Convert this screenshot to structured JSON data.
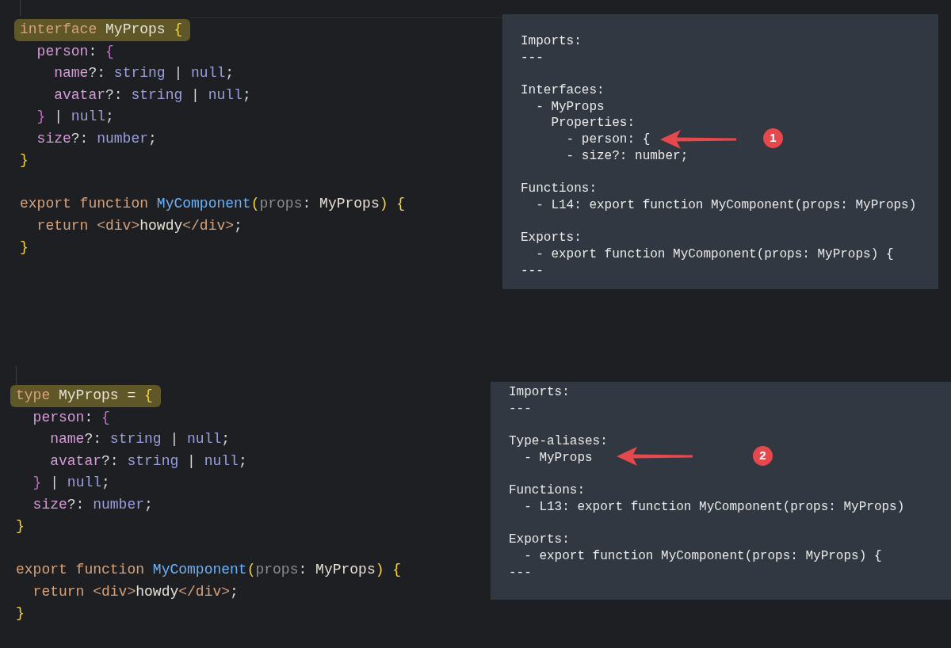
{
  "examples": [
    {
      "code": [
        {
          "lines": [
            {
              "highlighted": true,
              "tokens": [
                {
                  "kind": "keyword",
                  "text": "interface "
                },
                {
                  "kind": "type",
                  "text": "MyProps "
                },
                {
                  "kind": "brace",
                  "text": "{"
                }
              ]
            },
            {
              "highlighted": false,
              "tokens": [
                {
                  "kind": "property",
                  "text": "  person"
                },
                {
                  "kind": "punct",
                  "text": ": "
                },
                {
                  "kind": "inner-brace",
                  "text": "{"
                }
              ]
            },
            {
              "highlighted": false,
              "tokens": [
                {
                  "kind": "property",
                  "text": "    name"
                },
                {
                  "kind": "punct",
                  "text": "?: "
                },
                {
                  "kind": "builtin",
                  "text": "string "
                },
                {
                  "kind": "punct",
                  "text": "| "
                },
                {
                  "kind": "builtin",
                  "text": "null"
                },
                {
                  "kind": "punct",
                  "text": ";"
                }
              ]
            },
            {
              "highlighted": false,
              "tokens": [
                {
                  "kind": "property",
                  "text": "    avatar"
                },
                {
                  "kind": "punct",
                  "text": "?: "
                },
                {
                  "kind": "builtin",
                  "text": "string "
                },
                {
                  "kind": "punct",
                  "text": "| "
                },
                {
                  "kind": "builtin",
                  "text": "null"
                },
                {
                  "kind": "punct",
                  "text": ";"
                }
              ]
            },
            {
              "highlighted": false,
              "tokens": [
                {
                  "kind": "inner-brace",
                  "text": "  } "
                },
                {
                  "kind": "punct",
                  "text": "| "
                },
                {
                  "kind": "builtin",
                  "text": "null"
                },
                {
                  "kind": "punct",
                  "text": ";"
                }
              ]
            },
            {
              "highlighted": false,
              "tokens": [
                {
                  "kind": "property",
                  "text": "  size"
                },
                {
                  "kind": "punct",
                  "text": "?: "
                },
                {
                  "kind": "builtin",
                  "text": "number"
                },
                {
                  "kind": "punct",
                  "text": ";"
                }
              ]
            },
            {
              "highlighted": false,
              "tokens": [
                {
                  "kind": "brace",
                  "text": "}"
                }
              ]
            }
          ]
        },
        {
          "lines": [
            {
              "highlighted": false,
              "tokens": [
                {
                  "kind": "keyword",
                  "text": "export function "
                },
                {
                  "kind": "function",
                  "text": "MyComponent"
                },
                {
                  "kind": "brace",
                  "text": "("
                },
                {
                  "kind": "param",
                  "text": "props"
                },
                {
                  "kind": "punct",
                  "text": ": "
                },
                {
                  "kind": "type",
                  "text": "MyProps"
                },
                {
                  "kind": "brace",
                  "text": ") {"
                }
              ]
            },
            {
              "highlighted": false,
              "tokens": [
                {
                  "kind": "keyword",
                  "text": "  return "
                },
                {
                  "kind": "tag",
                  "text": "<div>"
                },
                {
                  "kind": "text",
                  "text": "howdy"
                },
                {
                  "kind": "tag",
                  "text": "</div>"
                },
                {
                  "kind": "punct",
                  "text": ";"
                }
              ]
            },
            {
              "highlighted": false,
              "tokens": [
                {
                  "kind": "brace",
                  "text": "}"
                }
              ]
            }
          ]
        }
      ],
      "outline": [
        [
          "Imports:",
          "---"
        ],
        [
          "Interfaces:",
          "  - MyProps",
          "    Properties:",
          "      - person: {",
          "      - size?: number;"
        ],
        [
          "Functions:",
          "  - L14: export function MyComponent(props: MyProps)"
        ],
        [
          "Exports:",
          "  - export function MyComponent(props: MyProps) {",
          "---"
        ]
      ],
      "annotation": {
        "number": "1"
      }
    },
    {
      "code": [
        {
          "lines": [
            {
              "highlighted": true,
              "tokens": [
                {
                  "kind": "keyword",
                  "text": "type "
                },
                {
                  "kind": "type",
                  "text": "MyProps = "
                },
                {
                  "kind": "brace",
                  "text": "{"
                }
              ]
            },
            {
              "highlighted": false,
              "tokens": [
                {
                  "kind": "property",
                  "text": "  person"
                },
                {
                  "kind": "punct",
                  "text": ": "
                },
                {
                  "kind": "inner-brace",
                  "text": "{"
                }
              ]
            },
            {
              "highlighted": false,
              "tokens": [
                {
                  "kind": "property",
                  "text": "    name"
                },
                {
                  "kind": "punct",
                  "text": "?: "
                },
                {
                  "kind": "builtin",
                  "text": "string "
                },
                {
                  "kind": "punct",
                  "text": "| "
                },
                {
                  "kind": "builtin",
                  "text": "null"
                },
                {
                  "kind": "punct",
                  "text": ";"
                }
              ]
            },
            {
              "highlighted": false,
              "tokens": [
                {
                  "kind": "property",
                  "text": "    avatar"
                },
                {
                  "kind": "punct",
                  "text": "?: "
                },
                {
                  "kind": "builtin",
                  "text": "string "
                },
                {
                  "kind": "punct",
                  "text": "| "
                },
                {
                  "kind": "builtin",
                  "text": "null"
                },
                {
                  "kind": "punct",
                  "text": ";"
                }
              ]
            },
            {
              "highlighted": false,
              "tokens": [
                {
                  "kind": "inner-brace",
                  "text": "  } "
                },
                {
                  "kind": "punct",
                  "text": "| "
                },
                {
                  "kind": "builtin",
                  "text": "null"
                },
                {
                  "kind": "punct",
                  "text": ";"
                }
              ]
            },
            {
              "highlighted": false,
              "tokens": [
                {
                  "kind": "property",
                  "text": "  size"
                },
                {
                  "kind": "punct",
                  "text": "?: "
                },
                {
                  "kind": "builtin",
                  "text": "number"
                },
                {
                  "kind": "punct",
                  "text": ";"
                }
              ]
            },
            {
              "highlighted": false,
              "tokens": [
                {
                  "kind": "brace",
                  "text": "}"
                }
              ]
            }
          ]
        },
        {
          "lines": [
            {
              "highlighted": false,
              "tokens": [
                {
                  "kind": "keyword",
                  "text": "export function "
                },
                {
                  "kind": "function",
                  "text": "MyComponent"
                },
                {
                  "kind": "brace",
                  "text": "("
                },
                {
                  "kind": "param",
                  "text": "props"
                },
                {
                  "kind": "punct",
                  "text": ": "
                },
                {
                  "kind": "type",
                  "text": "MyProps"
                },
                {
                  "kind": "brace",
                  "text": ") {"
                }
              ]
            },
            {
              "highlighted": false,
              "tokens": [
                {
                  "kind": "keyword",
                  "text": "  return "
                },
                {
                  "kind": "tag",
                  "text": "<div>"
                },
                {
                  "kind": "text",
                  "text": "howdy"
                },
                {
                  "kind": "tag",
                  "text": "</div>"
                },
                {
                  "kind": "punct",
                  "text": ";"
                }
              ]
            },
            {
              "highlighted": false,
              "tokens": [
                {
                  "kind": "brace",
                  "text": "}"
                }
              ]
            }
          ]
        }
      ],
      "outline": [
        [
          "Imports:",
          "---"
        ],
        [
          "Type-aliases:",
          "  - MyProps"
        ],
        [
          "Functions:",
          "  - L13: export function MyComponent(props: MyProps)"
        ],
        [
          "Exports:",
          "  - export function MyComponent(props: MyProps) {",
          "---"
        ]
      ],
      "annotation": {
        "number": "2"
      }
    }
  ]
}
